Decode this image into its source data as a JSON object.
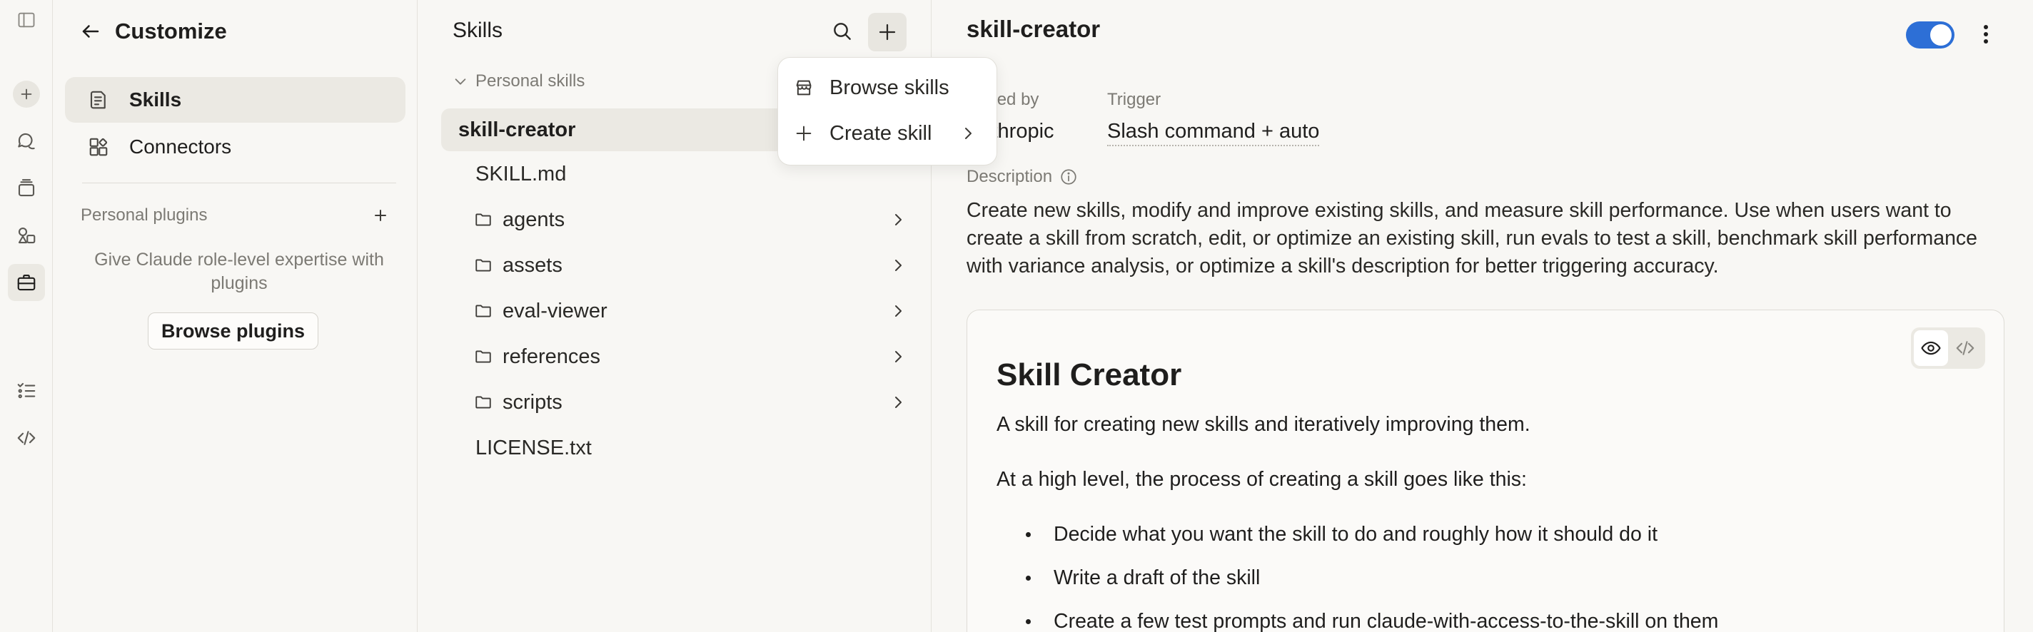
{
  "rail": {
    "icons": [
      "sidebar-toggle-icon",
      "new-chat-icon",
      "chats-icon",
      "projects-icon",
      "artifacts-icon",
      "customize-icon",
      "tasks-icon",
      "code-icon"
    ]
  },
  "customize": {
    "title": "Customize",
    "nav": [
      {
        "label": "Skills",
        "icon": "skills-icon",
        "active": true
      },
      {
        "label": "Connectors",
        "icon": "connectors-icon",
        "active": false
      }
    ],
    "plugins_label": "Personal plugins",
    "plugins_desc": "Give Claude role-level expertise with plugins",
    "browse_plugins": "Browse plugins"
  },
  "skills": {
    "title": "Skills",
    "section": "Personal skills",
    "selected_skill": "skill-creator",
    "files": [
      {
        "name": "SKILL.md",
        "type": "file"
      },
      {
        "name": "agents",
        "type": "folder"
      },
      {
        "name": "assets",
        "type": "folder"
      },
      {
        "name": "eval-viewer",
        "type": "folder"
      },
      {
        "name": "references",
        "type": "folder"
      },
      {
        "name": "scripts",
        "type": "folder"
      },
      {
        "name": "LICENSE.txt",
        "type": "file"
      }
    ]
  },
  "dropdown": {
    "browse": "Browse skills",
    "create": "Create skill"
  },
  "detail": {
    "title": "skill-creator",
    "enabled": true,
    "added_by_label": "Added by",
    "added_by_value": "Anthropic",
    "trigger_label": "Trigger",
    "trigger_value": "Slash command + auto",
    "description_label": "Description",
    "description": "Create new skills, modify and improve existing skills, and measure skill performance. Use when users want to create a skill from scratch, edit, or optimize an existing skill, run evals to test a skill, benchmark skill performance with variance analysis, or optimize a skill's description for better triggering accuracy.",
    "doc": {
      "heading": "Skill Creator",
      "p1": "A skill for creating new skills and iteratively improving them.",
      "p2": "At a high level, the process of creating a skill goes like this:",
      "bullets": [
        "Decide what you want the skill to do and roughly how it should do it",
        "Write a draft of the skill",
        "Create a few test prompts and run claude-with-access-to-the-skill on them"
      ]
    }
  },
  "colors": {
    "accent": "#2d6fd6",
    "background": "#f8f7f4",
    "selected": "#ebe9e3"
  }
}
